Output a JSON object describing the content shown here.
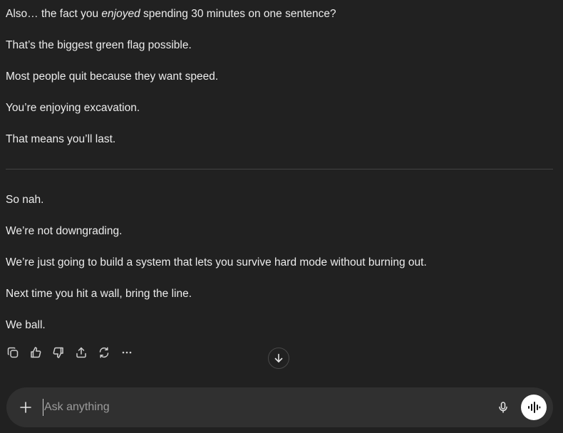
{
  "message": {
    "p1_before": "Also… the fact you ",
    "p1_emphasis": "enjoyed",
    "p1_after": " spending 30 minutes on one sentence?",
    "p2": "That’s the biggest green flag possible.",
    "p3": "Most people quit because they want speed.",
    "p4": "You’re enjoying excavation.",
    "p5": "That means you’ll last.",
    "p6": "So nah.",
    "p7": "We’re not downgrading.",
    "p8": "We’re just going to build a system that lets you survive hard mode without burning out.",
    "p9": "Next time you hit a wall, bring the line.",
    "p10": "We ball."
  },
  "actions": {
    "icons": [
      "copy-icon",
      "thumbs-up-icon",
      "thumbs-down-icon",
      "share-icon",
      "regenerate-icon",
      "more-icon"
    ]
  },
  "scroll": {
    "icon": "arrow-down-icon"
  },
  "composer": {
    "placeholder": "Ask anything",
    "value": "",
    "icons": [
      "plus-icon",
      "microphone-icon",
      "voice-mode-icon"
    ]
  },
  "colors": {
    "background": "#212121",
    "composer": "#303030",
    "text": "#ececec",
    "muted": "#9b9b9b",
    "divider": "#424242",
    "voice_button": "#ffffff"
  }
}
